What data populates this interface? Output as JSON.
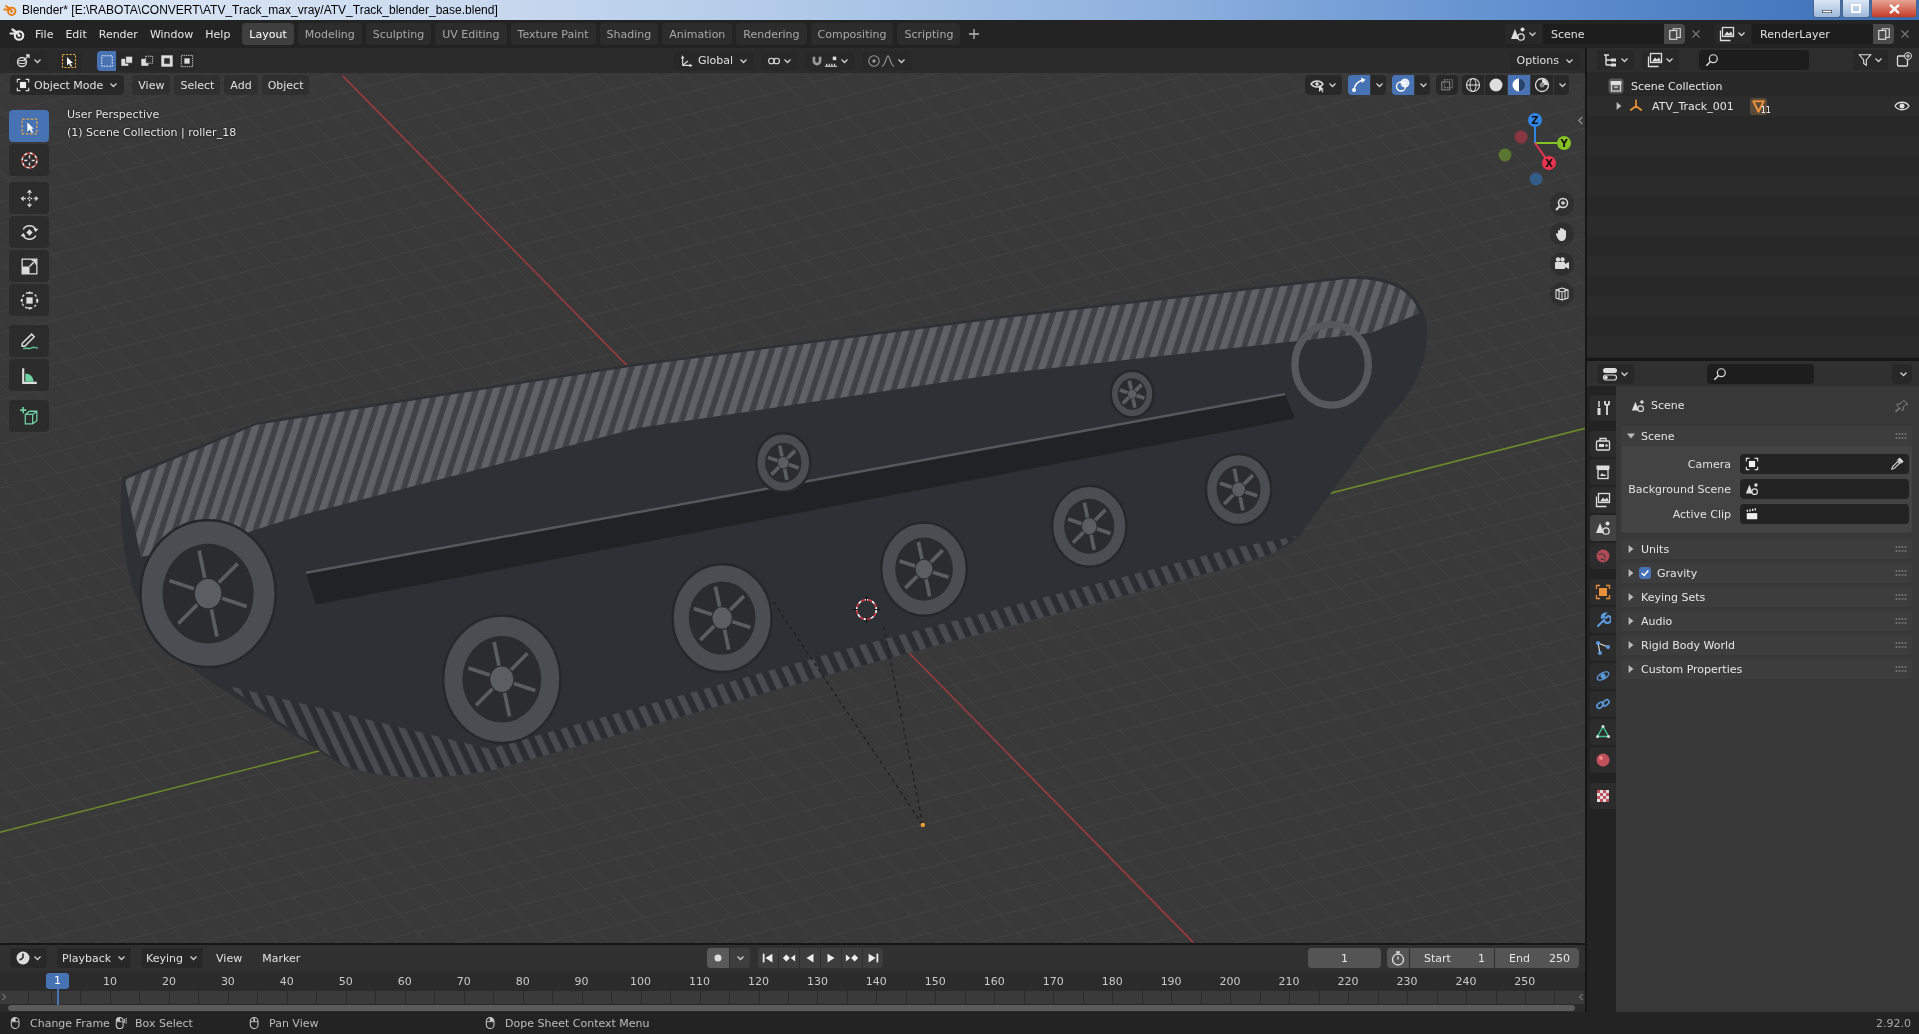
{
  "window": {
    "title": "Blender* [E:\\RABOTA\\CONVERT\\ATV_Track_max_vray/ATV_Track_blender_base.blend]"
  },
  "top_bar": {
    "menus": [
      "File",
      "Edit",
      "Render",
      "Window",
      "Help"
    ],
    "workspace_tabs": [
      {
        "label": "Layout",
        "selected": true
      },
      {
        "label": "Modeling",
        "selected": false
      },
      {
        "label": "Sculpting",
        "selected": false
      },
      {
        "label": "UV Editing",
        "selected": false
      },
      {
        "label": "Texture Paint",
        "selected": false
      },
      {
        "label": "Shading",
        "selected": false
      },
      {
        "label": "Animation",
        "selected": false
      },
      {
        "label": "Rendering",
        "selected": false
      },
      {
        "label": "Compositing",
        "selected": false
      },
      {
        "label": "Scripting",
        "selected": false
      }
    ],
    "scene": "Scene",
    "view_layer": "RenderLayer"
  },
  "viewport": {
    "select_modes": [
      {
        "selected": true
      },
      {
        "selected": false
      },
      {
        "selected": false
      },
      {
        "selected": false
      },
      {
        "selected": false
      }
    ],
    "transform_orientation": "Global",
    "options": "Options",
    "mode": "Object Mode",
    "menus": [
      "View",
      "Select",
      "Add",
      "Object"
    ],
    "show_gizmos": true,
    "show_overlays": true,
    "xray": false,
    "shading_modes": [
      {
        "selected": false
      },
      {
        "selected": false
      },
      {
        "selected": true
      },
      {
        "selected": false
      }
    ],
    "tools": [
      {
        "selected": true
      },
      {
        "selected": false
      },
      {
        "selected": false
      },
      {
        "selected": false
      },
      {
        "selected": false
      },
      {
        "selected": false
      },
      {
        "selected": false
      },
      {
        "selected": false
      },
      {
        "selected": false
      }
    ],
    "info": [
      "User Perspective",
      "(1) Scene Collection | roller_18"
    ],
    "gizmo_axes": [
      {
        "label": "Z",
        "color": "#2f86e8"
      },
      {
        "label": "Y",
        "color": "#86c226"
      },
      {
        "label": "X",
        "color": "#e8344e"
      }
    ]
  },
  "outliner": {
    "tree": [
      {
        "label": "Scene Collection",
        "children": [
          {
            "label": "ATV_Track_001",
            "expanded": false,
            "modifier_count": "11",
            "visible": true
          }
        ]
      }
    ]
  },
  "properties": {
    "tabs": [
      {
        "selected": false
      },
      {
        "selected": false
      },
      {
        "selected": false
      },
      {
        "selected": false
      },
      {
        "selected": true
      },
      {
        "selected": false
      },
      {
        "selected": false
      },
      {
        "selected": false
      },
      {
        "selected": false
      },
      {
        "selected": false
      },
      {
        "selected": false
      },
      {
        "selected": false
      },
      {
        "selected": false
      },
      {
        "selected": false
      }
    ],
    "context": "Scene",
    "panels": [
      {
        "kind": "fields",
        "title": "Scene",
        "expanded": true,
        "fields": [
          "Camera",
          "Background Scene",
          "Active Clip"
        ]
      },
      {
        "kind": "plain",
        "title": "Units",
        "expanded": false
      },
      {
        "kind": "checkbox",
        "title": "Gravity",
        "expanded": false,
        "checked": true
      },
      {
        "kind": "plain",
        "title": "Keying Sets",
        "expanded": false
      },
      {
        "kind": "plain",
        "title": "Audio",
        "expanded": false
      },
      {
        "kind": "plain",
        "title": "Rigid Body World",
        "expanded": false
      },
      {
        "kind": "plain",
        "title": "Custom Properties",
        "expanded": false
      }
    ]
  },
  "timeline": {
    "menus": [
      {
        "label": "Playback",
        "kind": "dropdown"
      },
      {
        "label": "Keying",
        "kind": "dropdown"
      },
      {
        "label": "View",
        "kind": "menu"
      },
      {
        "label": "Marker",
        "kind": "menu"
      }
    ],
    "current_frame": "1",
    "start_label": "Start",
    "start": "1",
    "end_label": "End",
    "end": "250",
    "playhead": "1",
    "ticks": [
      "10",
      "20",
      "30",
      "40",
      "50",
      "60",
      "70",
      "80",
      "90",
      "100",
      "110",
      "120",
      "130",
      "140",
      "150",
      "160",
      "170",
      "180",
      "190",
      "200",
      "210",
      "220",
      "230",
      "240",
      "250"
    ]
  },
  "status_bar": {
    "hints": [
      "Change Frame",
      "Box Select",
      "Pan View",
      "Dope Sheet Context Menu"
    ],
    "version": "2.92.0"
  }
}
